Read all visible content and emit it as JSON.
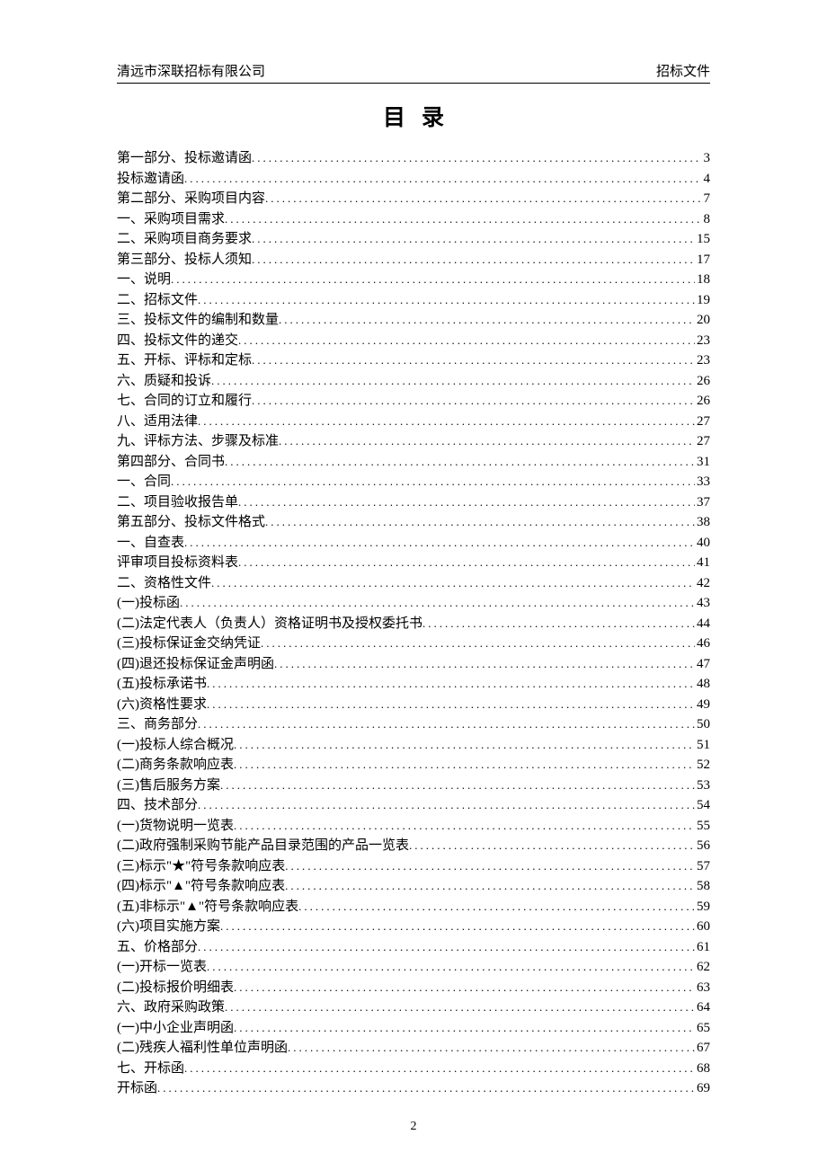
{
  "header": {
    "left": "清远市深联招标有限公司",
    "right": "招标文件"
  },
  "title": "目录",
  "toc": [
    {
      "label": "第一部分、投标邀请函",
      "page": "3"
    },
    {
      "label": "投标邀请函",
      "page": "4"
    },
    {
      "label": "第二部分、采购项目内容",
      "page": "7"
    },
    {
      "label": "一、采购项目需求",
      "page": "8"
    },
    {
      "label": "二、采购项目商务要求",
      "page": "15"
    },
    {
      "label": "第三部分、投标人须知",
      "page": "17"
    },
    {
      "label": "一、说明",
      "page": "18"
    },
    {
      "label": "二、招标文件",
      "page": "19"
    },
    {
      "label": "三、投标文件的编制和数量",
      "page": "20"
    },
    {
      "label": "四、投标文件的递交",
      "page": "23"
    },
    {
      "label": "五、开标、评标和定标",
      "page": "23"
    },
    {
      "label": "六、质疑和投诉",
      "page": "26"
    },
    {
      "label": "七、合同的订立和履行",
      "page": "26"
    },
    {
      "label": "八、适用法律",
      "page": "27"
    },
    {
      "label": "九、评标方法、步骤及标准",
      "page": "27"
    },
    {
      "label": "第四部分、合同书",
      "page": "31"
    },
    {
      "label": "一、合同",
      "page": "33"
    },
    {
      "label": "二、项目验收报告单",
      "page": "37"
    },
    {
      "label": "第五部分、投标文件格式",
      "page": "38"
    },
    {
      "label": "一、自查表",
      "page": "40"
    },
    {
      "label": "评审项目投标资料表",
      "page": "41"
    },
    {
      "label": "二、资格性文件",
      "page": "42"
    },
    {
      "label": "(一)投标函",
      "page": "43"
    },
    {
      "label": "(二)法定代表人（负责人）资格证明书及授权委托书",
      "page": "44"
    },
    {
      "label": "(三)投标保证金交纳凭证",
      "page": "46"
    },
    {
      "label": "(四)退还投标保证金声明函",
      "page": "47"
    },
    {
      "label": "(五)投标承诺书",
      "page": "48"
    },
    {
      "label": "(六)资格性要求",
      "page": "49"
    },
    {
      "label": "三、商务部分",
      "page": "50"
    },
    {
      "label": "(一)投标人综合概况",
      "page": "51"
    },
    {
      "label": "(二)商务条款响应表",
      "page": "52"
    },
    {
      "label": "(三)售后服务方案",
      "page": "53"
    },
    {
      "label": "四、技术部分",
      "page": "54"
    },
    {
      "label": "(一)货物说明一览表",
      "page": "55"
    },
    {
      "label": "(二)政府强制采购节能产品目录范围的产品一览表",
      "page": "56"
    },
    {
      "label": "(三)标示\"★\"符号条款响应表",
      "page": "57"
    },
    {
      "label": "(四)标示\"▲\"符号条款响应表",
      "page": "58"
    },
    {
      "label": "(五)非标示\"▲\"符号条款响应表",
      "page": "59"
    },
    {
      "label": "(六)项目实施方案",
      "page": "60"
    },
    {
      "label": "五、价格部分",
      "page": "61"
    },
    {
      "label": "(一)开标一览表",
      "page": "62"
    },
    {
      "label": "(二)投标报价明细表",
      "page": "63"
    },
    {
      "label": "六、政府采购政策",
      "page": "64"
    },
    {
      "label": "(一)中小企业声明函",
      "page": "65"
    },
    {
      "label": "(二)残疾人福利性单位声明函",
      "page": "67"
    },
    {
      "label": "七、开标函",
      "page": "68"
    },
    {
      "label": "开标函",
      "page": "69"
    }
  ],
  "footer_page": "2"
}
